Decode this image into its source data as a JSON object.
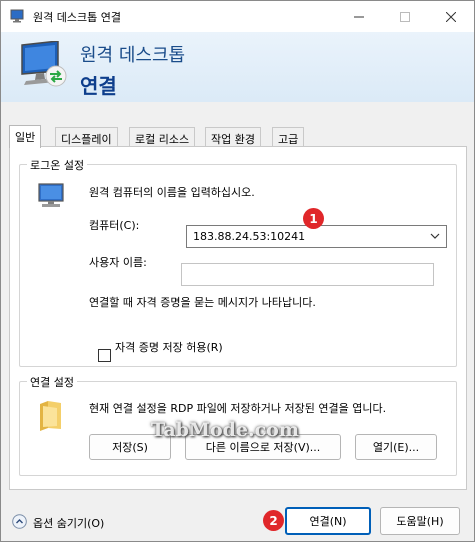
{
  "window": {
    "title": "원격 데스크톱 연결",
    "icons": {
      "app": "remote-desktop-icon",
      "minimize": "minimize-icon",
      "maximize": "maximize-icon",
      "close": "close-icon"
    }
  },
  "banner": {
    "line1": "원격 데스크톱",
    "line2": "연결",
    "icon": "monitor-connection-icon"
  },
  "tabs": [
    {
      "label": "일반",
      "active": true
    },
    {
      "label": "디스플레이",
      "active": false
    },
    {
      "label": "로컬 리소스",
      "active": false
    },
    {
      "label": "작업 환경",
      "active": false
    },
    {
      "label": "고급",
      "active": false
    }
  ],
  "logon": {
    "legend": "로그온 설정",
    "prompt": "원격 컴퓨터의 이름을 입력하십시오.",
    "computer_label": "컴퓨터(C):",
    "computer_value": "183.88.24.53:10241",
    "user_label": "사용자 이름:",
    "user_value": "",
    "note": "연결할 때 자격 증명을 묻는 메시지가 나타납니다.",
    "save_credentials_label": "자격 증명 저장 허용(R)",
    "save_credentials_checked": false,
    "icon": "computer-icon"
  },
  "connection": {
    "legend": "연결 설정",
    "description": "현재 연결 설정을 RDP 파일에 저장하거나 저장된 연결을 엽니다.",
    "save_label": "저장(S)",
    "save_as_label": "다른 이름으로 저장(V)...",
    "open_label": "열기(E)...",
    "icon": "folder-icon"
  },
  "footer": {
    "options_label": "옵션 숨기기(O)",
    "connect_label": "연결(N)",
    "help_label": "도움말(H)",
    "options_icon": "chevron-up-circle-icon"
  },
  "annotations": {
    "badge1": "1",
    "badge2": "2",
    "watermark": "TabMode.com",
    "badge_color": "#e0272a"
  }
}
